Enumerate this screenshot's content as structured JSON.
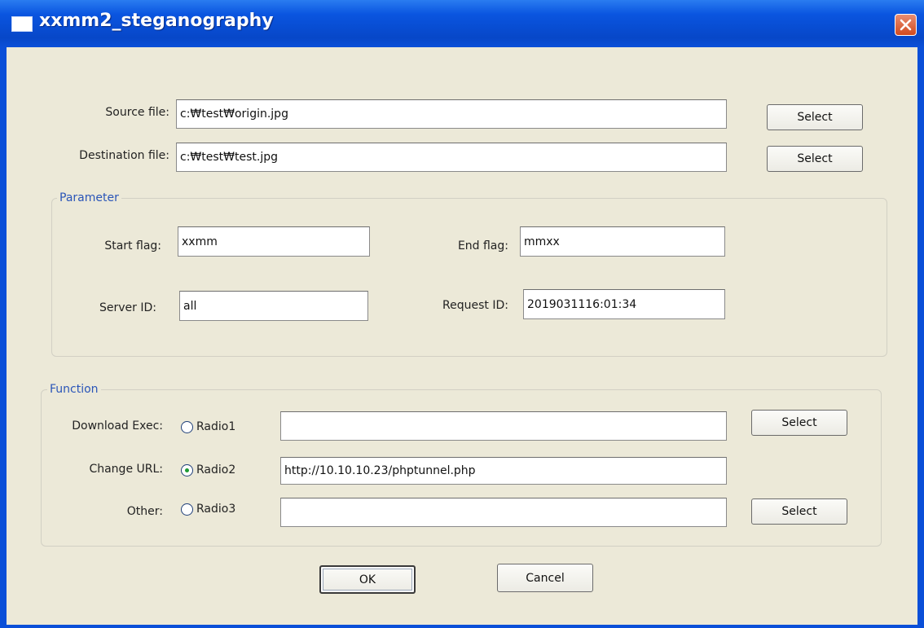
{
  "window": {
    "title": "xxmm2_steganography"
  },
  "files": {
    "source_label": "Source file:",
    "source_value": "c:₩test₩origin.jpg",
    "dest_label": "Destination file:",
    "dest_value": "c:₩test₩test.jpg",
    "select_label": "Select"
  },
  "parameter": {
    "title": "Parameter",
    "start_flag_label": "Start flag:",
    "start_flag_value": "xxmm",
    "end_flag_label": "End flag:",
    "end_flag_value": "mmxx",
    "server_id_label": "Server ID:",
    "server_id_value": "all",
    "request_id_label": "Request ID:",
    "request_id_value": "2019031116:01:34"
  },
  "function": {
    "title": "Function",
    "rows": [
      {
        "label": "Download  Exec:",
        "radio": "Radio1",
        "value": "",
        "selected": false,
        "button": "Select"
      },
      {
        "label": "Change URL:",
        "radio": "Radio2",
        "value": "http://10.10.10.23/phptunnel.php",
        "selected": true,
        "button": ""
      },
      {
        "label": "Other:",
        "radio": "Radio3",
        "value": "",
        "selected": false,
        "button": "Select"
      }
    ]
  },
  "actions": {
    "ok": "OK",
    "cancel": "Cancel"
  },
  "colors": {
    "titlebar": "#0a55e0",
    "dialog_bg": "#ece9d8",
    "group_title": "#2a55b8",
    "close": "#d24a1e"
  },
  "icons": [
    "window-app-icon",
    "close-icon"
  ]
}
